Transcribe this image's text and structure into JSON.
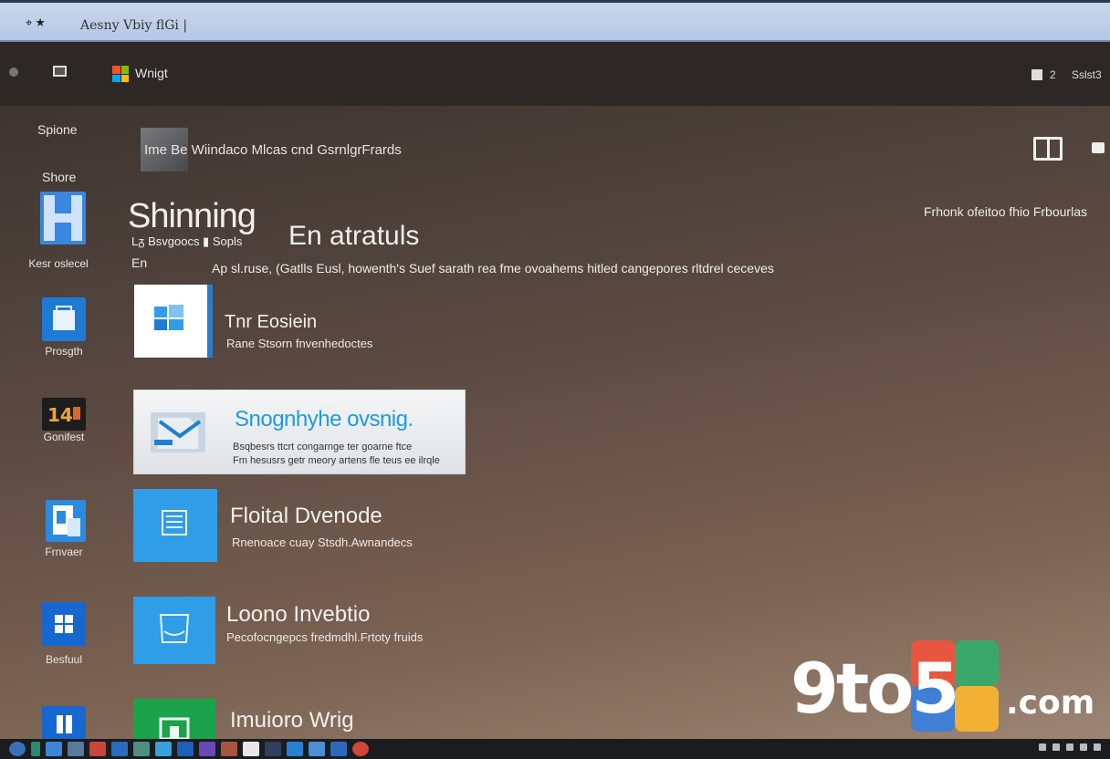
{
  "titlebar": {
    "pin": "⌖ ★",
    "title": "Aesny Vbiy flGi   |"
  },
  "appbar": {
    "app_title": "Wnigt",
    "right_num": "2",
    "right_text": "Sslst3"
  },
  "sidebar": {
    "label_1": "Spione",
    "label_2": "Shore",
    "items": [
      {
        "label": "Kesr oslecel",
        "color": "#3a86e0",
        "icon": "h-icon"
      },
      {
        "label": "Prosgth",
        "color": "#1f7ad6",
        "icon": "store-icon"
      },
      {
        "label": "Gonifest",
        "color": "#1d1d1d",
        "icon": "media-icon"
      },
      {
        "label": "Frnvaer",
        "color": "#2a8be0",
        "icon": "document-icon"
      },
      {
        "label": "Besfuul",
        "color": "#1667d0",
        "icon": "windows-icon"
      }
    ]
  },
  "header": {
    "text": "Ime Be Wiindaco Mlcas cnd GsrnlgrFrards",
    "caption": "Frhonk ofeitoo fhio Frbourlas"
  },
  "hero": {
    "title": "Shinning",
    "subtitle": "En atratuls",
    "small_row": "Lᵹ   Bsvgoocs ▮ Sopls",
    "cursor": "En",
    "description": "Ap sl.ruse, (Gatlls Eusl, howenth's Suef sarath rea fme ovoahems hitled cangepores rltdrel ceceves"
  },
  "cards": [
    {
      "title": "Tnr Eosiein",
      "sub": "Rane Stsorn fnvenhedoctes",
      "color": "#ffffff",
      "icon": "windows-tile-icon"
    },
    {
      "title": "Floital Dvenode",
      "sub": "Rnenoace cuay Stsdh.Awnandecs",
      "color": "#2f9de8",
      "icon": "file-icon"
    },
    {
      "title": "Loono Invebtio",
      "sub": "Pecofocngepcs fredmdhl.Frtoty fruids",
      "color": "#2f9de8",
      "icon": "device-icon"
    },
    {
      "title": "Imuioro Wrig",
      "sub": "",
      "color": "#1aa34a",
      "icon": "green-icon"
    }
  ],
  "feature": {
    "title": "Snognhyhe ovsnig.",
    "line1": "Bsqbesrs ttcrt congarnge ter goarne ftce",
    "line2": "Fm hesusrs getr meory artens fle teus ee ilrqle"
  },
  "watermark": {
    "text": "9to5",
    "suffix": ".com"
  },
  "colors": {
    "accent": "#1e9be1",
    "titlebar": "#c3d3ea"
  }
}
